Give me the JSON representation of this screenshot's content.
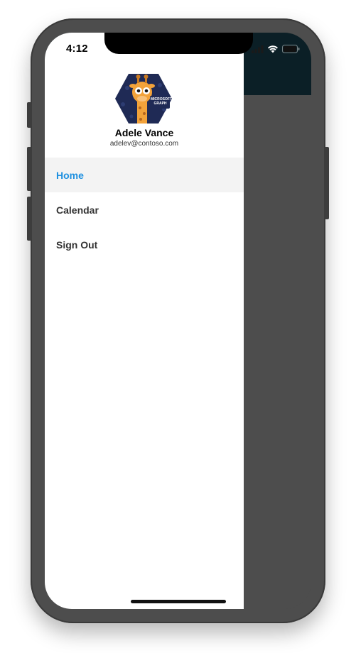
{
  "status_bar": {
    "time": "4:12",
    "icons": [
      "signal-icon",
      "wifi-icon",
      "battery-icon"
    ]
  },
  "drawer": {
    "avatar_icon": "microsoft-graph-giraffe-avatar",
    "avatar_badge_text": "MICROSOFT GRAPH",
    "user_name": "Adele Vance",
    "user_email": "adelev@contoso.com",
    "menu_items": [
      {
        "label": "Home",
        "active": true
      },
      {
        "label": "Calendar",
        "active": false
      },
      {
        "label": "Sign Out",
        "active": false
      }
    ]
  },
  "colors": {
    "accent": "#1e90e0",
    "navbar": "#0b1f26",
    "active_item_bg": "#f3f3f3",
    "overlay": "#4d4d4d"
  }
}
